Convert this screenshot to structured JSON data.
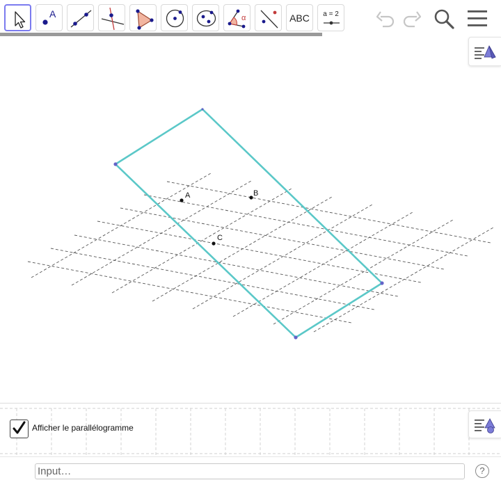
{
  "toolbar": {
    "tools": [
      {
        "name": "move-tool",
        "selected": true
      },
      {
        "name": "point-tool",
        "label": "A"
      },
      {
        "name": "line-tool"
      },
      {
        "name": "perpendicular-line-tool"
      },
      {
        "name": "polygon-tool"
      },
      {
        "name": "circle-tool"
      },
      {
        "name": "conic-tool"
      },
      {
        "name": "angle-tool",
        "label": "α"
      },
      {
        "name": "reflect-tool"
      },
      {
        "name": "text-tool",
        "label": "ABC"
      },
      {
        "name": "slider-tool",
        "label": "a = 2"
      }
    ],
    "actions": [
      "undo-icon",
      "redo-icon",
      "search-icon",
      "menu-icon"
    ]
  },
  "graphics": {
    "points": [
      {
        "label": "A"
      },
      {
        "label": "B"
      },
      {
        "label": "C"
      }
    ],
    "colors": {
      "parallelogram": "#5bc8c8",
      "vertex": "#6464c8",
      "grid": "#444444",
      "accent": "#7b7bef"
    }
  },
  "algebra": {
    "checkbox_checked": true,
    "checkbox_label": "Afficher le parallélogramme"
  },
  "input_bar": {
    "placeholder": "Input…",
    "help_label": "?"
  }
}
